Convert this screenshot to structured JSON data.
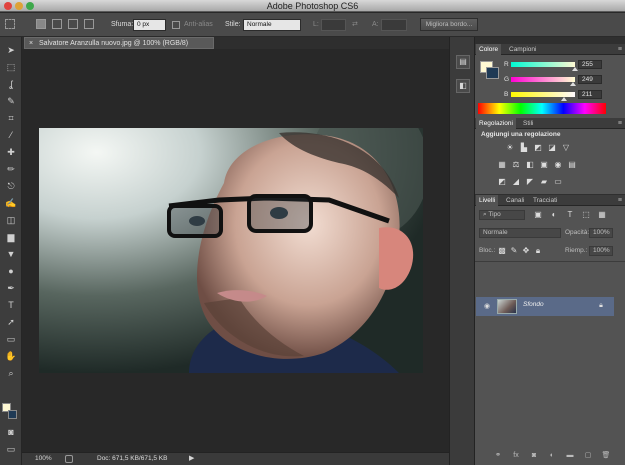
{
  "colors": {
    "accent": "#5a6a88",
    "panel": "#535353",
    "background": "#282828"
  },
  "window": {
    "title": "Adobe Photoshop CS6"
  },
  "options": {
    "sfuma_label": "Sfuma:",
    "sfuma_value": "0 px",
    "antialias_label": "Anti-alias",
    "style_label": "Stile:",
    "style_value": "Normale",
    "width_label": "L:",
    "height_label": "A:",
    "refine_label": "Migliora bordo..."
  },
  "document": {
    "tab_title": "Salvatore Aranzulla nuovo.jpg @ 100% (RGB/8)",
    "close": "×"
  },
  "status": {
    "zoom": "100%",
    "doc_info": "Doc: 671,5 KB/671,5 KB"
  },
  "panels": {
    "color": {
      "tabs": [
        "Colore",
        "Campioni"
      ],
      "channels": [
        {
          "label": "R",
          "value": "255",
          "level": 1.0
        },
        {
          "label": "G",
          "value": "249",
          "level": 0.976
        },
        {
          "label": "B",
          "value": "211",
          "level": 0.827
        }
      ],
      "foreground": "#fff9d3",
      "background_swatch": "#1f3a55"
    },
    "adjustments": {
      "tabs": [
        "Regolazioni",
        "Stili"
      ],
      "heading": "Aggiungi una regolazione"
    },
    "layers": {
      "tabs": [
        "Livelli",
        "Canali",
        "Tracciati"
      ],
      "filter": "Tipo",
      "blend": "Normale",
      "opacity_label": "Opacità:",
      "opacity_value": "100%",
      "lock_label": "Bloc.:",
      "fill_label": "Riemp.:",
      "fill_value": "100%",
      "items": [
        {
          "name": "Sfondo",
          "locked": true,
          "visible": true
        }
      ]
    }
  },
  "icons": {
    "tools": [
      "move-tool-icon",
      "marquee-tool-icon",
      "lasso-tool-icon",
      "quick-select-tool-icon",
      "crop-tool-icon",
      "eyedropper-tool-icon",
      "healing-brush-tool-icon",
      "brush-tool-icon",
      "clone-stamp-tool-icon",
      "history-brush-tool-icon",
      "eraser-tool-icon",
      "gradient-tool-icon",
      "blur-tool-icon",
      "dodge-tool-icon",
      "pen-tool-icon",
      "type-tool-icon",
      "path-select-tool-icon",
      "shape-tool-icon",
      "hand-tool-icon",
      "zoom-tool-icon"
    ]
  }
}
